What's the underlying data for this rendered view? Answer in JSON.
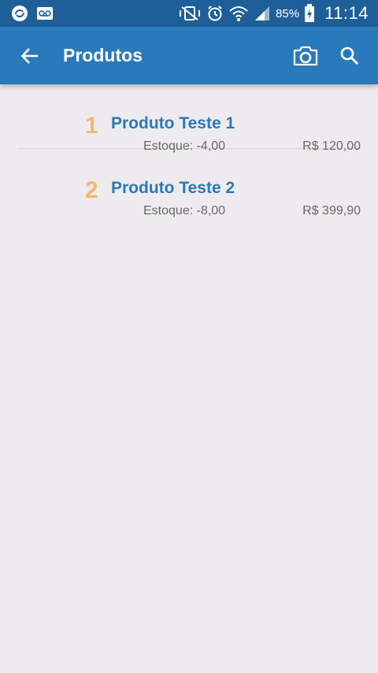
{
  "status_bar": {
    "battery": "85%",
    "time": "11:14"
  },
  "app_bar": {
    "title": "Produtos",
    "color": "#2a7abb"
  },
  "products": [
    {
      "index": "1",
      "name": "Produto Teste 1",
      "stock": "Estoque: -4,00",
      "price": "R$ 120,00"
    },
    {
      "index": "2",
      "name": "Produto Teste 2",
      "stock": "Estoque: -8,00",
      "price": "R$ 399,90"
    }
  ]
}
